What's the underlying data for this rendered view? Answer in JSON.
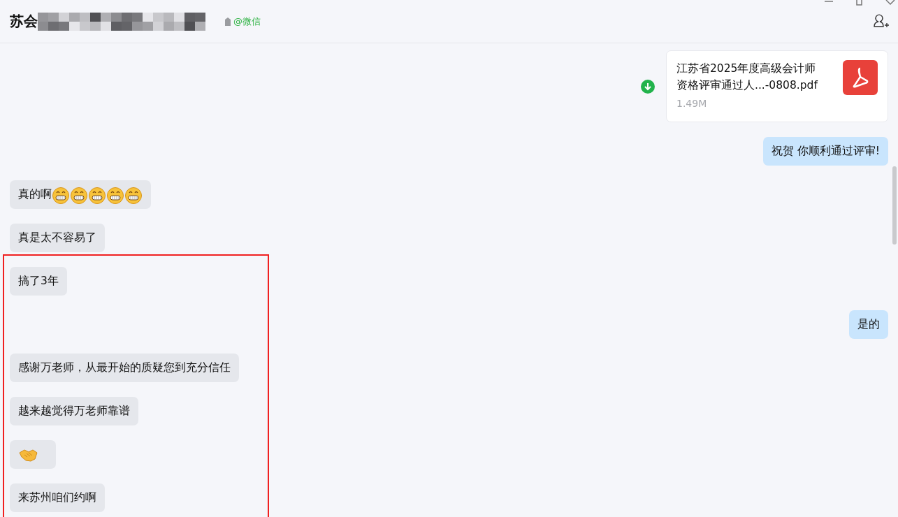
{
  "header": {
    "title": "苏会",
    "source": "@微信"
  },
  "messages": [
    {
      "sent": true,
      "kind": "file",
      "file_name": "江苏省2025年度高级会计师资格评审通过人...-0808.pdf",
      "size": "1.49M"
    },
    {
      "sent": true,
      "kind": "text",
      "text": "祝贺 你顺利通过评审!"
    },
    {
      "sent": false,
      "kind": "text",
      "text": "真的啊",
      "emojis": [
        {
          "kind": "grin"
        },
        {
          "kind": "grin"
        },
        {
          "kind": "grin"
        },
        {
          "kind": "grin"
        },
        {
          "kind": "grin"
        }
      ]
    },
    {
      "sent": false,
      "kind": "text",
      "text": "真是太不容易了"
    },
    {
      "sent": false,
      "kind": "text",
      "text": "搞了3年"
    },
    {
      "sent": true,
      "kind": "text",
      "text": "是的"
    },
    {
      "sent": false,
      "kind": "text",
      "text": "感谢万老师，从最开始的质疑您到充分信任"
    },
    {
      "sent": false,
      "kind": "text",
      "text": "越来越觉得万老师靠谱"
    },
    {
      "sent": false,
      "kind": "emoji",
      "emojis": [
        {
          "kind": "handshake"
        }
      ]
    },
    {
      "sent": false,
      "kind": "text",
      "text": "来苏州咱们约啊"
    }
  ]
}
